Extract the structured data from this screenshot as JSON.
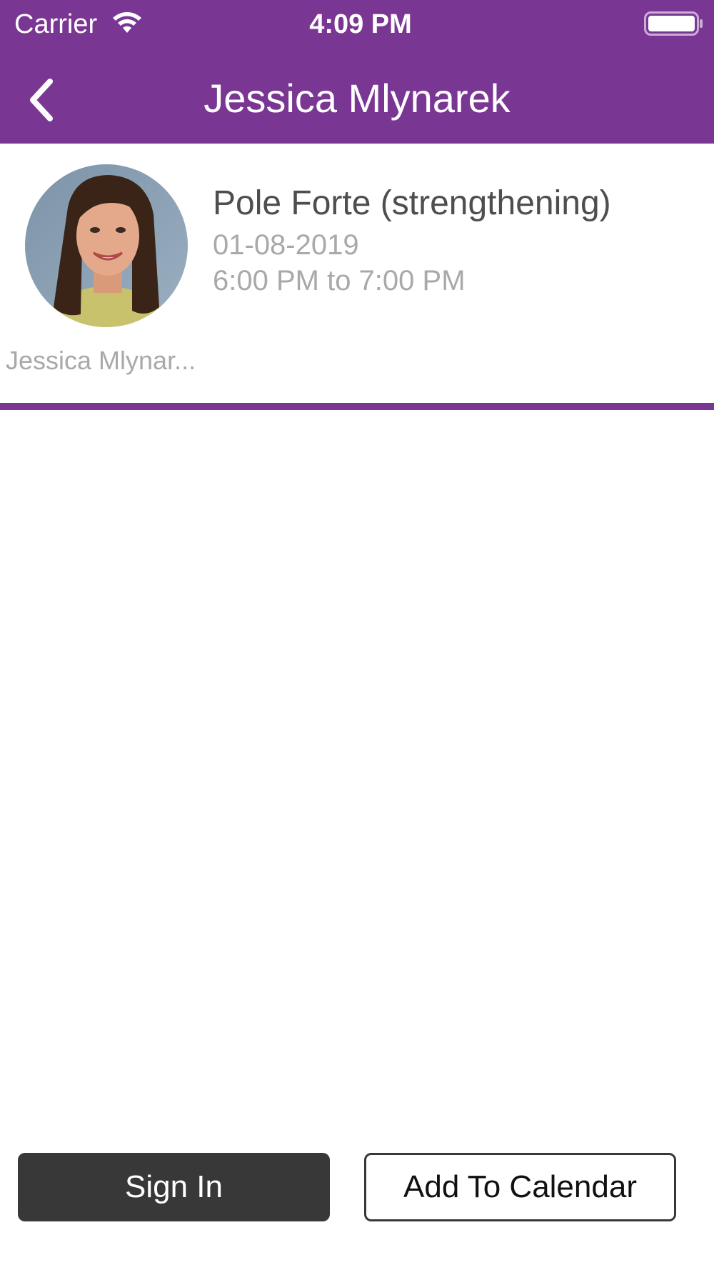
{
  "status_bar": {
    "carrier": "Carrier",
    "time": "4:09 PM",
    "wifi_icon": "wifi-icon",
    "battery_icon": "battery-icon"
  },
  "nav": {
    "title": "Jessica Mlynarek",
    "back_icon": "chevron-left-icon"
  },
  "class_info": {
    "name": "Pole Forte (strengthening)",
    "date": "01-08-2019",
    "time_range": "6:00 PM to 7:00 PM",
    "instructor": "Jessica Mlynar..."
  },
  "actions": {
    "sign_in_label": "Sign In",
    "add_to_calendar_label": "Add To Calendar"
  },
  "colors": {
    "accent": "#7a3693",
    "primary_button": "#383838",
    "subtle_text": "#a9a9a9",
    "title_text": "#4e4e4e"
  }
}
